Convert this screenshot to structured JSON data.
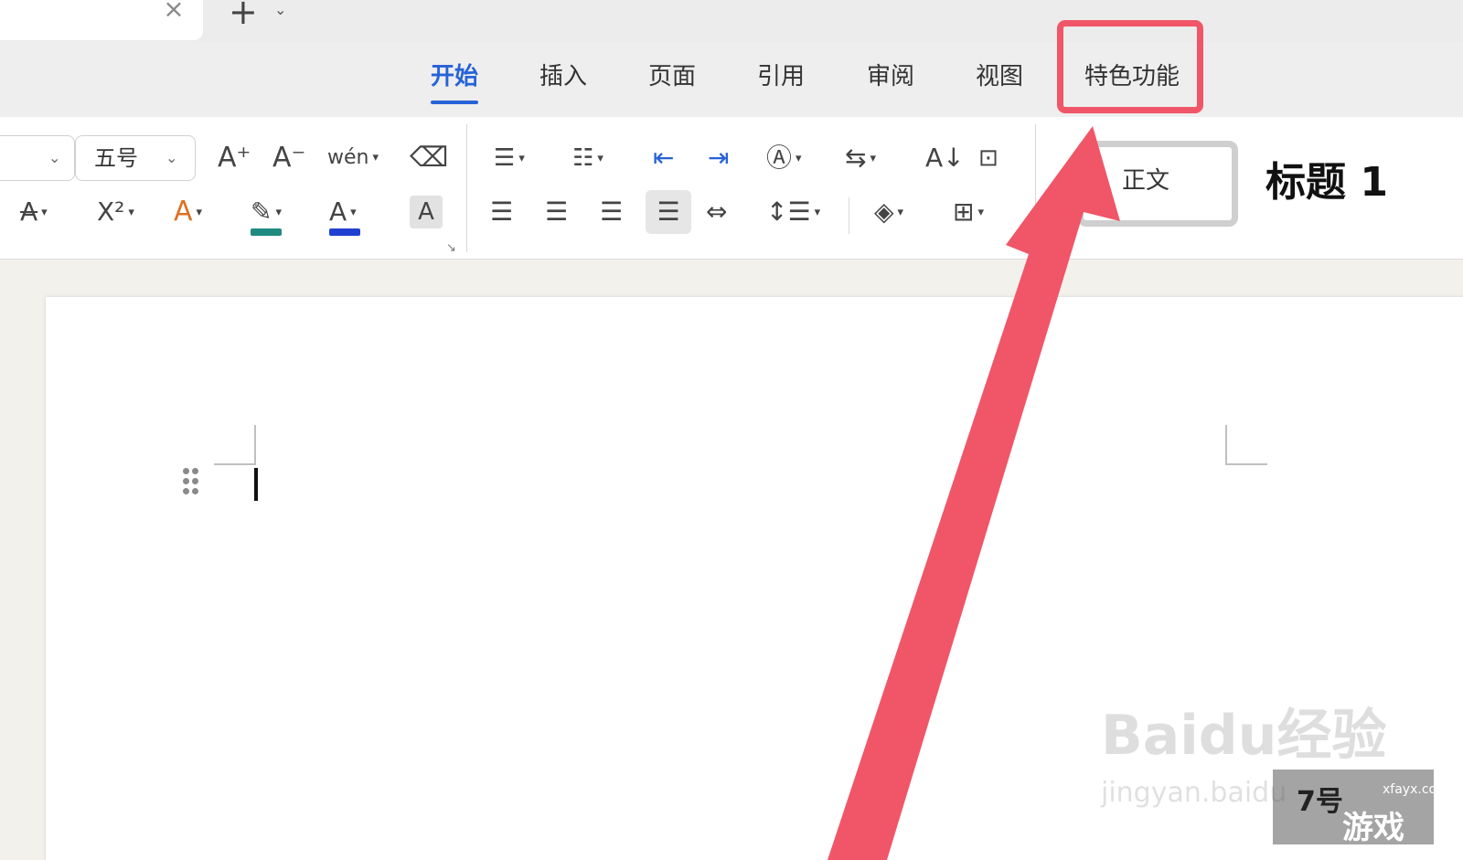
{
  "tab_strip": {
    "close_glyph": "×",
    "new_tab_glyph": "+",
    "new_tab_caret": "⌄"
  },
  "ribbon_tabs": [
    {
      "label": "开始",
      "active": true
    },
    {
      "label": "插入"
    },
    {
      "label": "页面"
    },
    {
      "label": "引用"
    },
    {
      "label": "审阅"
    },
    {
      "label": "视图"
    },
    {
      "label": "特色功能",
      "highlighted": true
    }
  ],
  "toolbar": {
    "font_size": "五号",
    "grow_font_glyph": "A⁺",
    "shrink_font_glyph": "A⁻",
    "pinyin_glyph": "wén",
    "clear_format_glyph": "⌫",
    "strike_glyph": "A",
    "superscript_glyph": "X²",
    "text_effect_glyph": "A",
    "highlight_glyph": "✎",
    "font_color_glyph": "A",
    "char_shading_glyph": "A",
    "highlight_color": "#1f8a80",
    "font_color": "#2040d0"
  },
  "styles": {
    "normal": "正文",
    "heading1": "标题 1"
  },
  "watermark": {
    "baidu": "Baidu经验",
    "url": "jingyan.baidu",
    "game_a": "7号",
    "game_b": "游戏",
    "game_c": "xfayx.com"
  },
  "colors": {
    "accent": "#2662d8",
    "annotation": "#f05668"
  }
}
